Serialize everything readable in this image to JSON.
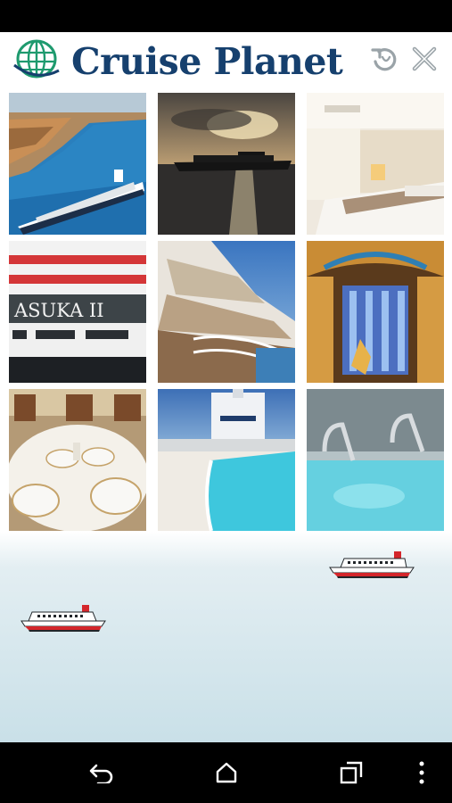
{
  "app": {
    "title": "Cruise Planet",
    "logo_icon": "globe-logo-icon",
    "colors": {
      "brand": "#16406e",
      "logo_green": "#1e9a6e"
    }
  },
  "header": {
    "actions": [
      {
        "icon": "refresh-icon"
      },
      {
        "icon": "close-icon"
      }
    ]
  },
  "gallery": {
    "tiles": [
      {
        "subject": "city-harbor-ship"
      },
      {
        "subject": "sunset-ship"
      },
      {
        "subject": "cabin-beds"
      },
      {
        "subject": "ship-funnel",
        "text": "ASUKA II"
      },
      {
        "subject": "ship-decks"
      },
      {
        "subject": "atrium"
      },
      {
        "subject": "dining-table"
      },
      {
        "subject": "deck-pool"
      },
      {
        "subject": "jacuzzi"
      }
    ]
  },
  "decorations": {
    "ships": [
      {
        "icon": "cruise-ship-icon"
      },
      {
        "icon": "cruise-ship-icon"
      }
    ]
  },
  "navigation": {
    "buttons": [
      {
        "icon": "back-icon"
      },
      {
        "icon": "home-icon"
      },
      {
        "icon": "recents-icon"
      },
      {
        "icon": "more-icon"
      }
    ]
  }
}
